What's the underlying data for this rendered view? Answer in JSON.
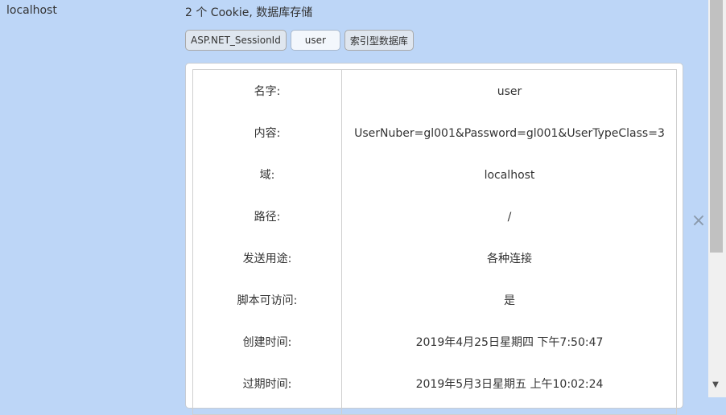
{
  "site": {
    "domain": "localhost",
    "summary": "2 个 Cookie, 数据库存储"
  },
  "chips": [
    {
      "label": "ASP.NET_SessionId"
    },
    {
      "label": "user"
    },
    {
      "label": "索引型数据库"
    }
  ],
  "details": {
    "name": {
      "label": "名字:",
      "value": "user"
    },
    "content": {
      "label": "内容:",
      "value": "UserNuber=gl001&Password=gl001&UserTypeClass=3"
    },
    "domain": {
      "label": "域:",
      "value": "localhost"
    },
    "path": {
      "label": "路径:",
      "value": "/"
    },
    "send_for": {
      "label": "发送用途:",
      "value": "各种连接"
    },
    "script_access": {
      "label": "脚本可访问:",
      "value": "是"
    },
    "created": {
      "label": "创建时间:",
      "value": "2019年4月25日星期四 下午7:50:47"
    },
    "expires": {
      "label": "过期时间:",
      "value": "2019年5月3日星期五 上午10:02:24"
    }
  },
  "icons": {
    "close": "close-icon",
    "scroll_down": "scroll-down-arrow-icon"
  }
}
